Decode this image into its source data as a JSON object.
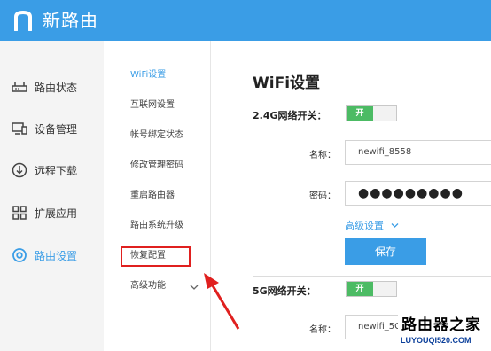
{
  "app": {
    "brand": "新路由",
    "accent": "#3a9de6"
  },
  "sidebar": {
    "items": [
      {
        "label": "路由状态",
        "icon": "router-status-icon"
      },
      {
        "label": "设备管理",
        "icon": "device-manage-icon"
      },
      {
        "label": "远程下载",
        "icon": "download-icon"
      },
      {
        "label": "扩展应用",
        "icon": "apps-grid-icon"
      },
      {
        "label": "路由设置",
        "icon": "settings-icon",
        "active": true
      }
    ]
  },
  "subnav": {
    "items": [
      {
        "label": "WiFi设置",
        "active": true
      },
      {
        "label": "互联网设置"
      },
      {
        "label": "帐号绑定状态"
      },
      {
        "label": "修改管理密码"
      },
      {
        "label": "重启路由器"
      },
      {
        "label": "路由系统升级"
      },
      {
        "label": "恢复配置",
        "highlighted": true
      },
      {
        "label": "高级功能",
        "expandable": true
      }
    ]
  },
  "main": {
    "title": "WiFi设置",
    "wifi24": {
      "label": "2.4G网络开关：",
      "toggle": "开",
      "name_label": "名称：",
      "name_value": "newifi_8558",
      "password_label": "密码：",
      "password_value": "●●●●●●●●●",
      "advanced": "高级设置",
      "save": "保存"
    },
    "wifi5": {
      "label": "5G网络开关：",
      "toggle": "开",
      "name_label": "名称：",
      "name_value": "newifi_5G"
    }
  },
  "watermark": {
    "title": "路由器之家",
    "url": "LUYOUQI520.COM"
  }
}
